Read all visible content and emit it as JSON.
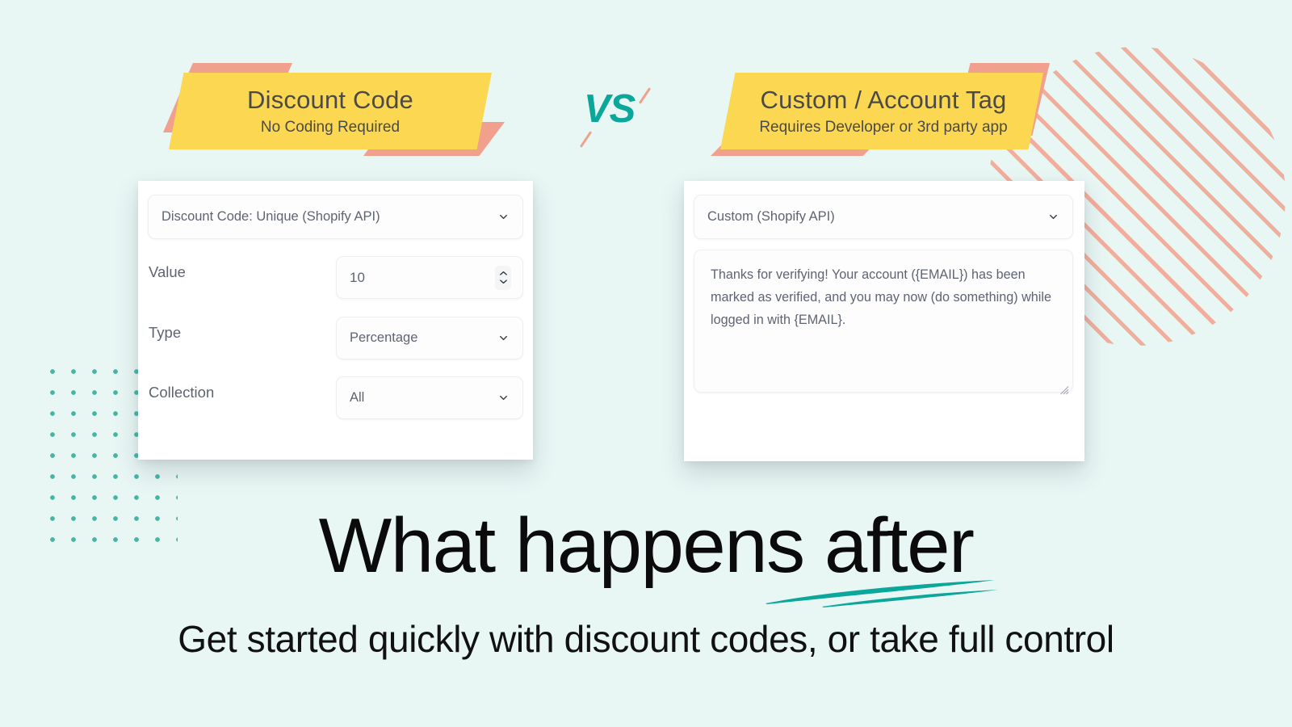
{
  "theme": {
    "background": "#e8f6f4",
    "banner_yellow": "#fcd852",
    "banner_accent_salmon": "#f0a08c",
    "teal_accent": "#0aa79a",
    "dot_teal": "#45b5a5",
    "text_dark": "#0b0b0b",
    "field_text": "#5d6472"
  },
  "banners": {
    "left": {
      "title": "Discount Code",
      "subtitle": "No Coding Required"
    },
    "right": {
      "title": "Custom / Account Tag",
      "subtitle": "Requires Developer or 3rd party app"
    },
    "versus_label": "VS"
  },
  "left_card": {
    "method_select": {
      "value": "Discount Code: Unique (Shopify API)",
      "icon": "chevron-down-icon"
    },
    "rows": [
      {
        "label": "Value",
        "value": "10",
        "control": "number"
      },
      {
        "label": "Type",
        "value": "Percentage",
        "control": "select"
      },
      {
        "label": "Collection",
        "value": "All",
        "control": "select"
      }
    ]
  },
  "right_card": {
    "method_select": {
      "value": "Custom (Shopify API)",
      "icon": "chevron-down-icon"
    },
    "message": "Thanks for verifying! Your account ({EMAIL}) has been marked as verified, and you may now (do something) while logged in with {EMAIL}."
  },
  "footer": {
    "headline": "What happens after",
    "subhead": "Get started quickly with discount codes, or take full control"
  }
}
